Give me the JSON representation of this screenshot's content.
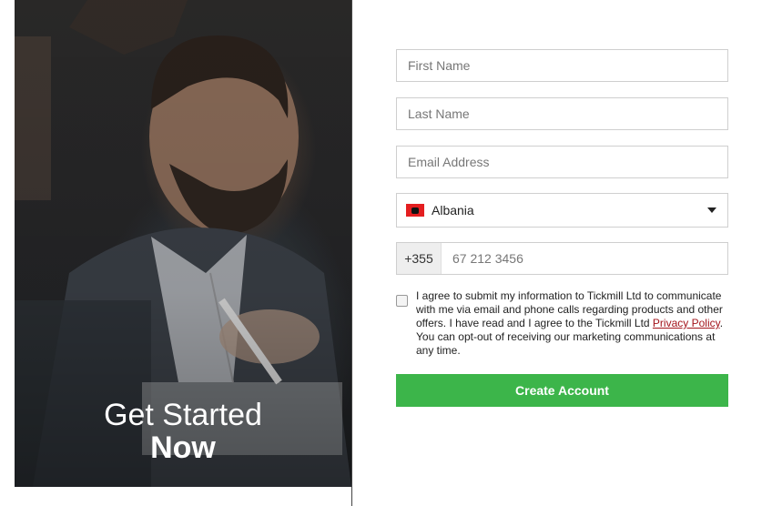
{
  "hero": {
    "title_line1": "Get Started",
    "title_line2": "Now"
  },
  "form": {
    "first_name_placeholder": "First Name",
    "last_name_placeholder": "Last Name",
    "email_placeholder": "Email Address",
    "country": {
      "selected": "Albania",
      "flag_icon": "albania-flag-icon",
      "dropdown_icon": "caret-down-icon"
    },
    "phone": {
      "prefix": "+355",
      "placeholder": "67 212 3456"
    },
    "consent": {
      "checked": false,
      "text_before_link": "I agree to submit my information to Tickmill Ltd to communicate with me via email and phone calls regarding products and other offers. I have read and I agree to the Tickmill Ltd ",
      "link_text": "Privacy Policy",
      "text_after_link": ". You can opt-out of receiving our marketing communications at any time."
    },
    "submit_label": "Create Account"
  },
  "colors": {
    "primary_button": "#3cb54a",
    "link": "#a3141b"
  }
}
